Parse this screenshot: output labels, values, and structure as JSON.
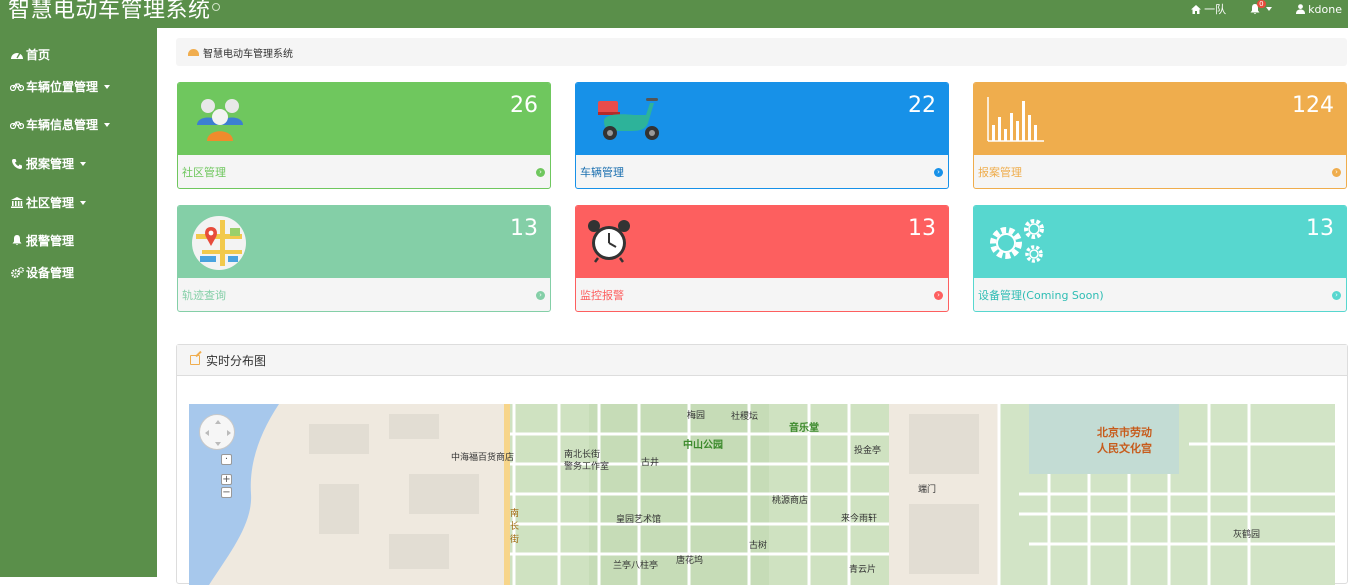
{
  "app": {
    "title": "智慧电动车管理系统"
  },
  "topnav": {
    "team": {
      "icon": "home-icon",
      "label": "一队"
    },
    "notifications": {
      "icon": "bell-icon",
      "badge": "0"
    },
    "user": {
      "icon": "user-icon",
      "label": "kdone"
    }
  },
  "sidebar": {
    "items": [
      {
        "label": "首页",
        "icon": "dashboard-icon",
        "has_caret": false
      },
      {
        "label": "车辆位置管理",
        "icon": "bicycle-icon",
        "has_caret": true
      },
      {
        "label": "车辆信息管理",
        "icon": "bicycle-icon",
        "has_caret": true
      },
      {
        "label": "报案管理",
        "icon": "phone-icon",
        "has_caret": true
      },
      {
        "label": "社区管理",
        "icon": "bank-icon",
        "has_caret": true
      },
      {
        "label": "报警管理",
        "icon": "bell-icon",
        "has_caret": false
      },
      {
        "label": "设备管理",
        "icon": "gears-icon",
        "has_caret": false
      }
    ]
  },
  "breadcrumb": {
    "icon": "dashboard-icon",
    "label": "智慧电动车管理系统"
  },
  "cards": [
    {
      "label": "社区管理",
      "count": "26",
      "icon": "users-icon",
      "color": "#6fc75e"
    },
    {
      "label": "车辆管理",
      "count": "22",
      "icon": "scooter-icon",
      "color": "#1791e8"
    },
    {
      "label": "报案管理",
      "count": "124",
      "icon": "bar-chart-icon",
      "color": "#efad4d"
    },
    {
      "label": "轨迹查询",
      "count": "13",
      "icon": "map-pin-icon",
      "color": "#84cfa7"
    },
    {
      "label": "监控报警",
      "count": "13",
      "icon": "alarm-clock-icon",
      "color": "#fd5f5f"
    },
    {
      "label": "设备管理(Coming Soon)",
      "count": "13",
      "icon": "gears-icon",
      "color": "#57d7cf"
    }
  ],
  "panel": {
    "title": "实时分布图",
    "icon": "edit-icon"
  },
  "map": {
    "labels": {
      "a": "中海福百货商店",
      "b": "南北长街",
      "b2": "警务工作室",
      "c": "古井",
      "d": "梅园",
      "e": "社稷坛",
      "f": "中山公园",
      "g": "音乐堂",
      "h": "投金亭",
      "i": "端门",
      "j": "北京市劳动",
      "j2": "人民文化宫",
      "k": "桃源商店",
      "l": "来今雨轩",
      "m": "皇园艺术馆",
      "n": "古树",
      "o": "南",
      "o2": "长",
      "o3": "街",
      "p": "兰亭八柱亭",
      "q": "唐花坞",
      "r": "青云片",
      "s": "灰鹤园"
    }
  },
  "colors": {
    "sidebar": "#5a8f4a",
    "accent": "#f0ad4e"
  }
}
